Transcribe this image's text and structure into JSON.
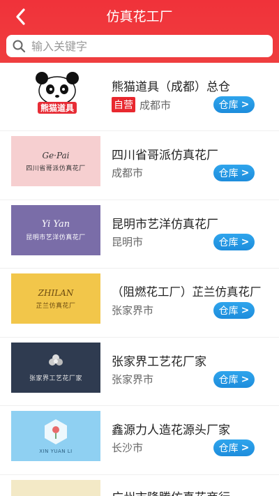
{
  "header": {
    "title": "仿真花工厂",
    "bg_color": "#f0323a",
    "back_icon": "back-arrow-icon"
  },
  "search": {
    "placeholder": "输入关键字",
    "icon": "search-icon"
  },
  "store_button_label": "仓库",
  "items": [
    {
      "name": "熊猫道具（成都）总仓",
      "badge": "自营",
      "city": "成都市",
      "thumb": {
        "text": "熊猫道具",
        "bg": "#ffffff"
      }
    },
    {
      "name": "四川省哥派仿真花厂",
      "city": "成都市",
      "thumb": {
        "logo": "Ge·Pai",
        "text": "四川省哥派仿真花厂",
        "bg": "#f6cfd0"
      }
    },
    {
      "name": "昆明市艺洋仿真花厂",
      "city": "昆明市",
      "thumb": {
        "logo": "Yi Yan",
        "text": "昆明市艺洋仿真花厂",
        "bg": "#7a6da8"
      }
    },
    {
      "name": "（阻燃花工厂）芷兰仿真花厂",
      "city": "张家界市",
      "thumb": {
        "logo": "ZHILAN",
        "text": "芷兰仿真花厂",
        "bg": "#f2c64a"
      }
    },
    {
      "name": "张家界工艺花厂家",
      "city": "张家界市",
      "thumb": {
        "text": "张家界工艺花厂家",
        "bg": "#2f3b50"
      }
    },
    {
      "name": "鑫源力人造花源头厂家",
      "city": "长沙市",
      "thumb": {
        "logo": "XIN YUAN LI",
        "bg": "#8fd0f2"
      }
    },
    {
      "name": "广州市隆腾仿真花商行",
      "city": "",
      "thumb": {
        "bg": "#f3e9c6"
      }
    }
  ]
}
